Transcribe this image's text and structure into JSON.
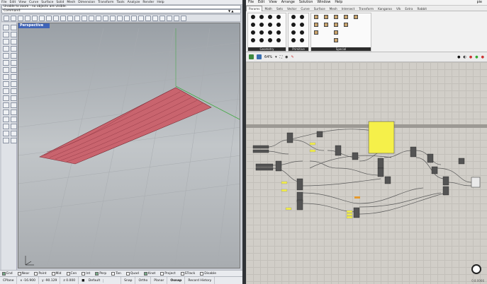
{
  "rhino": {
    "menu": [
      "File",
      "Edit",
      "View",
      "Curve",
      "Surface",
      "Solid",
      "Mesh",
      "Dimension",
      "Transform",
      "Tools",
      "Analyze",
      "Render",
      "Help"
    ],
    "command_history": "Unable to zoom - no objects are visible.",
    "command_prompt": "Command:",
    "viewport_label": "Perspective",
    "osnaps": [
      {
        "label": "End",
        "checked": true
      },
      {
        "label": "Near",
        "checked": false
      },
      {
        "label": "Point",
        "checked": false
      },
      {
        "label": "Mid",
        "checked": false
      },
      {
        "label": "Cen",
        "checked": false
      },
      {
        "label": "Int",
        "checked": false
      },
      {
        "label": "Perp",
        "checked": true
      },
      {
        "label": "Tan",
        "checked": false
      },
      {
        "label": "Quad",
        "checked": false
      },
      {
        "label": "Knot",
        "checked": true
      },
      {
        "label": "Project",
        "checked": false
      },
      {
        "label": "STrack",
        "checked": false
      },
      {
        "label": "Disable",
        "checked": false
      }
    ],
    "status": {
      "cplane": "CPlane",
      "x": "x -16.900",
      "y": "y -90.129",
      "z": "z 0.000",
      "layer": "Default",
      "snap": "Snap",
      "ortho": "Ortho",
      "planar": "Planar",
      "osnap": "Osnap",
      "history": "Record History"
    }
  },
  "grasshopper": {
    "menu": [
      "File",
      "Edit",
      "View",
      "Arrange",
      "Solution",
      "Window",
      "Help"
    ],
    "doc_name": "pie",
    "tabs": [
      "Params",
      "Math",
      "Sets",
      "Vector",
      "Curve",
      "Surface",
      "Mesh",
      "Intersect",
      "Transform",
      "Kangaroo",
      "Vlk",
      "Extra",
      "Rabbit"
    ],
    "panels": [
      "Geometry",
      "Primitive",
      "Special"
    ],
    "zoom": "64%",
    "version": "0.8.0066"
  },
  "colors": {
    "surface": "#c9646e",
    "viewport_label": "#3f64b8",
    "panel_yellow": "#f5f04a"
  }
}
